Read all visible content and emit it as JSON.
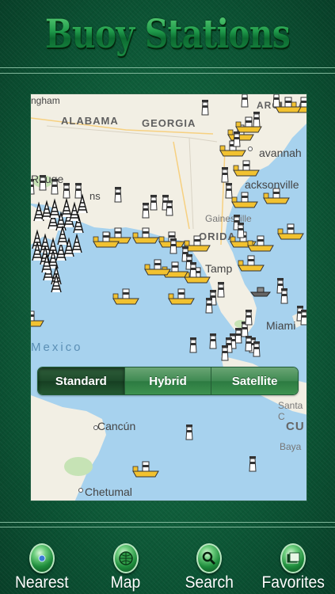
{
  "header": {
    "title": "Buoy Stations"
  },
  "map": {
    "labels": {
      "alabama": "ALABAMA",
      "georgia": "GEORGIA",
      "carolina": "AROLINA",
      "savannah": "avannah",
      "jacksonville": "acksonville",
      "gainesville": "Gainesville",
      "florida": "ORIDA",
      "tampa": "Tamp",
      "miami": "Miami",
      "mexico": "Mexico",
      "cancun": "Cancún",
      "chetumal": "Chetumal",
      "cu": "CU",
      "bay": "Baya",
      "rouge": "Rouge",
      "ns": "ns",
      "ngham": "ngham",
      "santa": "Santa C"
    },
    "map_types": {
      "standard": "Standard",
      "hybrid": "Hybrid",
      "satellite": "Satellite",
      "selected": "Standard"
    }
  },
  "tabs": {
    "nearest": "Nearest",
    "map": "Map",
    "search": "Search",
    "favorites": "Favorites"
  },
  "colors": {
    "background": "#0d5a37",
    "water": "#a7d2ee",
    "land": "#f2efe4",
    "buoy_yellow": "#f2c230"
  }
}
